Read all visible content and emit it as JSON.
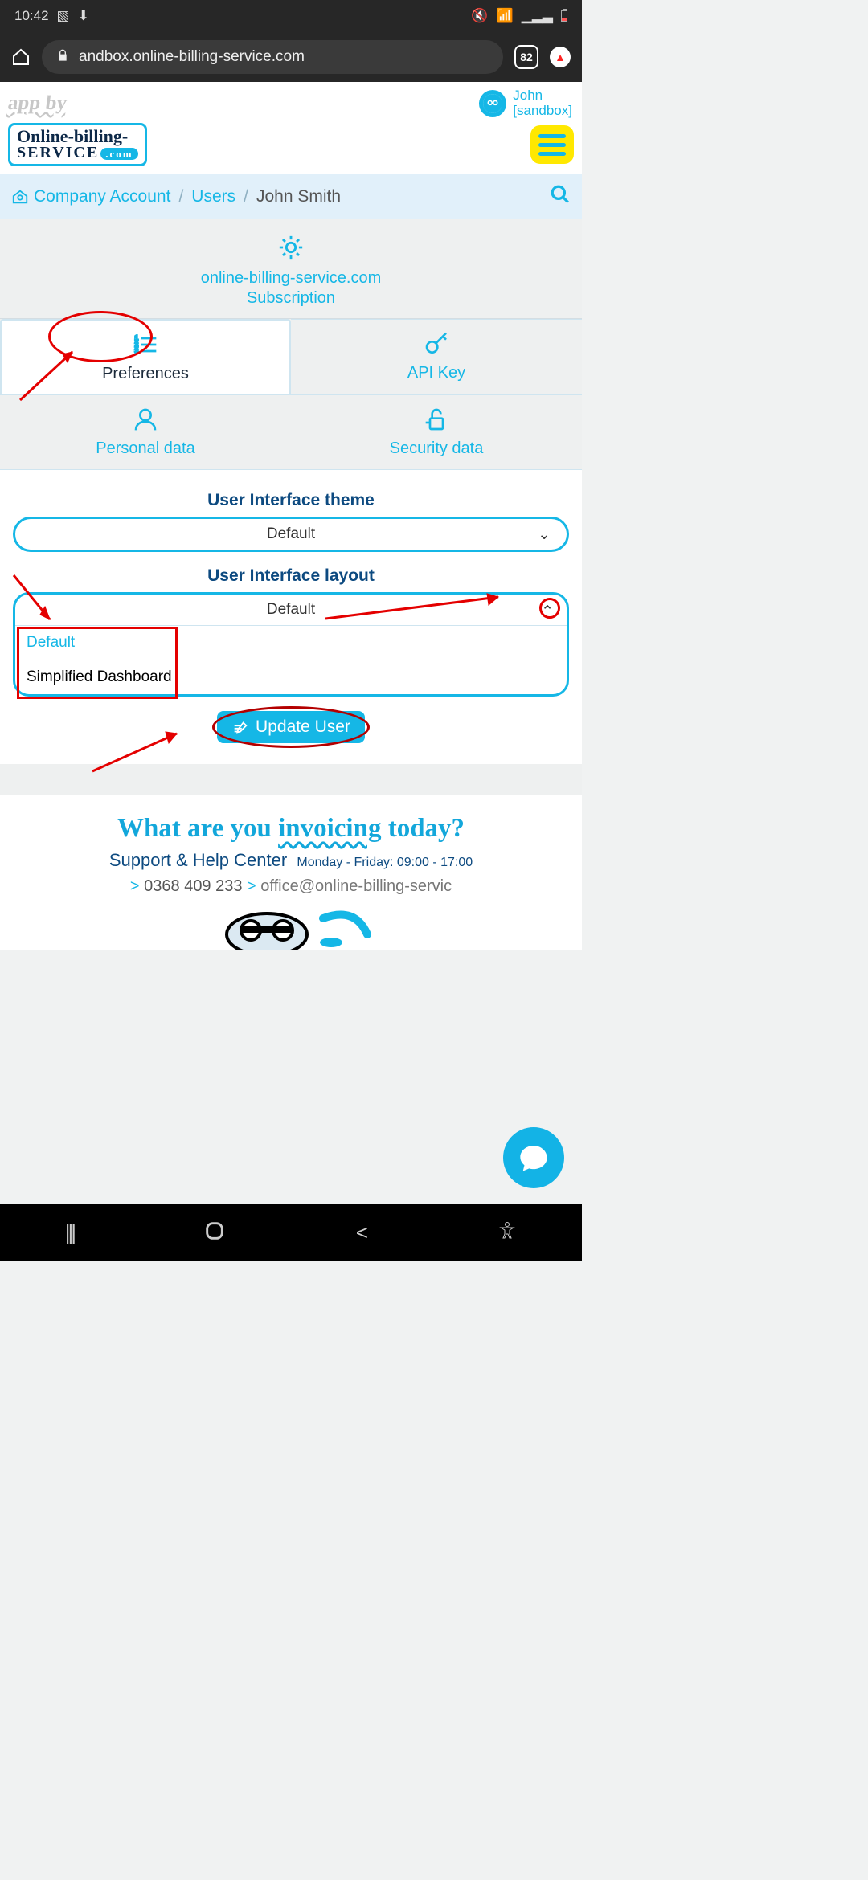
{
  "status": {
    "time": "10:42"
  },
  "browser": {
    "url": "andbox.online-billing-service.com",
    "tab_count": "82"
  },
  "header": {
    "app_by": "app by",
    "logo_line1": "Online-billing-",
    "logo_line2": "SERVICE",
    "logo_suffix": ".com",
    "user_name": "John",
    "user_env": "[sandbox]"
  },
  "breadcrumb": {
    "item1": "Company Account",
    "item2": "Users",
    "current": "John Smith"
  },
  "tabs": {
    "subscription_line1": "online-billing-service.com",
    "subscription_line2": "Subscription",
    "preferences": "Preferences",
    "api_key": "API Key",
    "personal": "Personal data",
    "security": "Security data"
  },
  "form": {
    "theme_label": "User Interface theme",
    "theme_value": "Default",
    "layout_label": "User Interface layout",
    "layout_current": "Default",
    "layout_options": {
      "default": "Default",
      "simplified": "Simplified Dashboard"
    },
    "submit": "Update User"
  },
  "footer": {
    "tagline_pre": "What are you ",
    "tagline_inv": "invoicing",
    "tagline_post": " today?",
    "support": "Support & Help Center",
    "hours": "Monday - Friday: 09:00 - 17:00",
    "phone": "0368 409 233",
    "email": "office@online-billing-servic"
  }
}
